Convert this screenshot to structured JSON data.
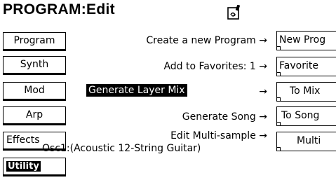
{
  "header": {
    "title": "PROGRAM:Edit",
    "icon": "edit-document-icon"
  },
  "tabs": [
    {
      "label": "Program"
    },
    {
      "label": "Synth"
    },
    {
      "label": "Mod"
    },
    {
      "label": "Arp"
    },
    {
      "label": "Effects"
    },
    {
      "label": "Utility",
      "selected": true
    }
  ],
  "commands": [
    {
      "label": "Create a new Program →",
      "button": "New Prog"
    },
    {
      "label": "Add to Favorites: 1 →",
      "button": "Favorite"
    },
    {
      "label": "Generate Layer Mix",
      "arrow": "→",
      "button": "To Mix"
    },
    {
      "label": "Generate Song →",
      "button": "To Song"
    },
    {
      "label": "Edit Multi-sample →",
      "button": "Multi"
    }
  ],
  "sample_info": "Osc1:(Acoustic 12-String Guitar)"
}
